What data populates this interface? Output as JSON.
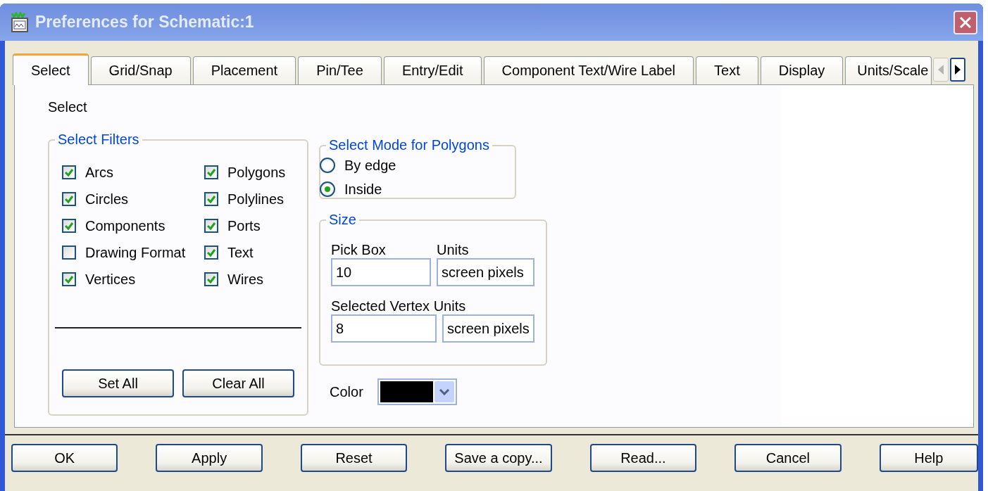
{
  "window": {
    "title": "Preferences for Schematic:1"
  },
  "tabs": [
    {
      "label": "Select",
      "selected": true
    },
    {
      "label": "Grid/Snap",
      "selected": false
    },
    {
      "label": "Placement",
      "selected": false
    },
    {
      "label": "Pin/Tee",
      "selected": false
    },
    {
      "label": "Entry/Edit",
      "selected": false
    },
    {
      "label": "Component Text/Wire Label",
      "selected": false
    },
    {
      "label": "Text",
      "selected": false
    },
    {
      "label": "Display",
      "selected": false
    },
    {
      "label": "Units/Scale",
      "selected": false
    }
  ],
  "page": {
    "heading": "Select",
    "select_filters": {
      "title": "Select Filters",
      "items": [
        {
          "label": "Arcs",
          "checked": true
        },
        {
          "label": "Circles",
          "checked": true
        },
        {
          "label": "Components",
          "checked": true
        },
        {
          "label": "Drawing Format",
          "checked": false
        },
        {
          "label": "Vertices",
          "checked": true
        },
        {
          "label": "Polygons",
          "checked": true
        },
        {
          "label": "Polylines",
          "checked": true
        },
        {
          "label": "Ports",
          "checked": true
        },
        {
          "label": "Text",
          "checked": true
        },
        {
          "label": "Wires",
          "checked": true
        }
      ],
      "buttons": [
        "Set All",
        "Clear All"
      ]
    },
    "polygon_mode": {
      "title": "Select Mode for Polygons",
      "options": [
        {
          "label": "By edge",
          "selected": false
        },
        {
          "label": "Inside",
          "selected": true
        }
      ]
    },
    "size": {
      "title": "Size",
      "pick_box": {
        "label": "Pick Box",
        "value": "10"
      },
      "pick_units": {
        "label": "Units",
        "value": "screen pixels"
      },
      "vertex": {
        "label": "Selected Vertex Units",
        "value": "8"
      },
      "vertex_units": {
        "value": "screen pixels"
      }
    },
    "color_field": {
      "label": "Color",
      "color": "#000000"
    }
  },
  "buttons": [
    "OK",
    "Apply",
    "Reset",
    "Save a copy...",
    "Read...",
    "Cancel",
    "Help"
  ]
}
